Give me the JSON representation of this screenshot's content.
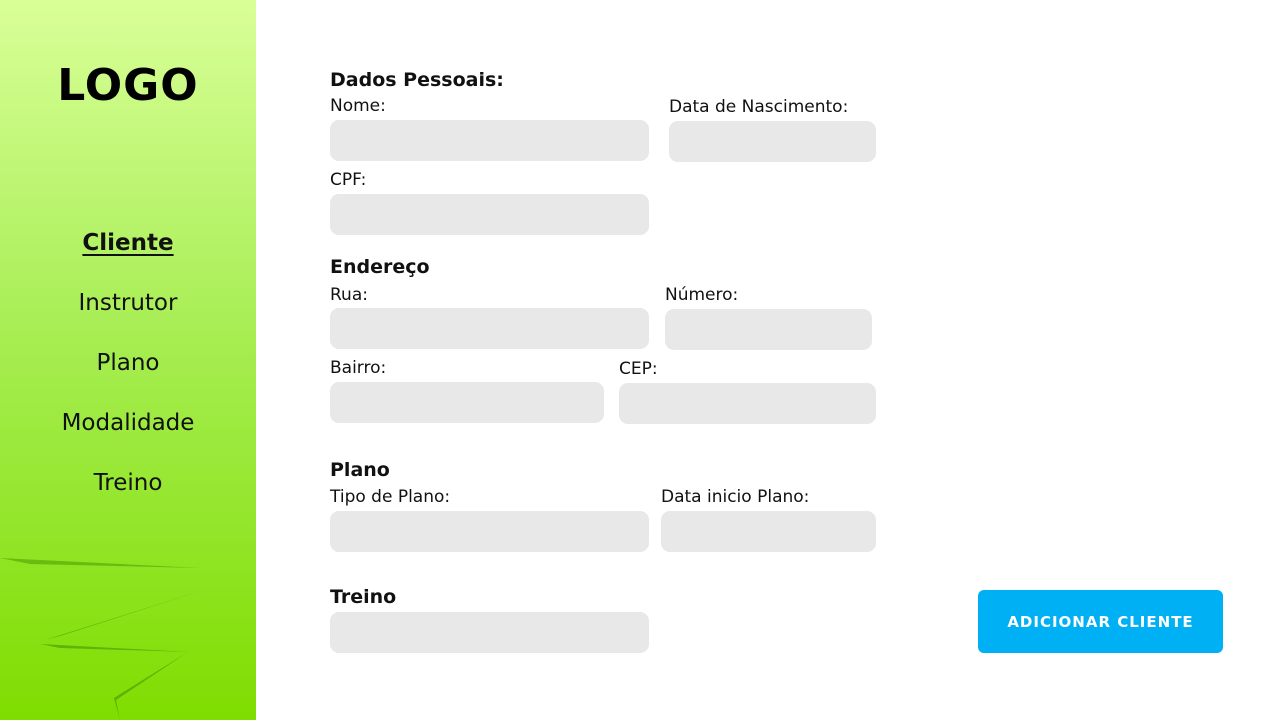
{
  "sidebar": {
    "logo": "LOGO",
    "items": [
      {
        "label": "Cliente",
        "active": true
      },
      {
        "label": "Instrutor",
        "active": false
      },
      {
        "label": "Plano",
        "active": false
      },
      {
        "label": "Modalidade",
        "active": false
      },
      {
        "label": "Treino",
        "active": false
      }
    ]
  },
  "form": {
    "dados_pessoais": {
      "title": "Dados Pessoais:",
      "nome_label": "Nome:",
      "nome_value": "",
      "nascimento_label": "Data de Nascimento:",
      "nascimento_value": "",
      "cpf_label": "CPF:",
      "cpf_value": ""
    },
    "endereco": {
      "title": "Endereço",
      "rua_label": "Rua:",
      "rua_value": "",
      "numero_label": "Número:",
      "numero_value": "",
      "bairro_label": "Bairro:",
      "bairro_value": "",
      "cep_label": "CEP:",
      "cep_value": ""
    },
    "plano": {
      "title": "Plano",
      "tipo_label": "Tipo de Plano:",
      "tipo_value": "",
      "inicio_label": "Data inicio Plano:",
      "inicio_value": ""
    },
    "treino": {
      "title": "Treino",
      "value": ""
    },
    "submit_label": "ADICIONAR CLIENTE"
  },
  "colors": {
    "sidebar_top": "#d9ff98",
    "sidebar_bottom": "#7fdd00",
    "field_bg": "#e8e8e8",
    "button_bg": "#00b0f5",
    "button_text": "#ffffff"
  }
}
